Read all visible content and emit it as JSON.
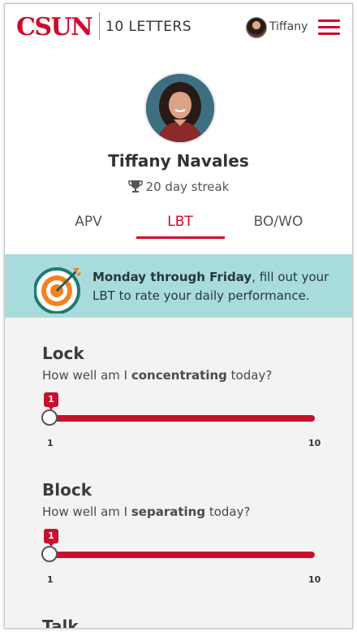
{
  "header": {
    "logo": "CSUN",
    "app_title": "10 LETTERS",
    "user_name": "Tiffany",
    "menu_icon": "hamburger-menu-icon"
  },
  "profile": {
    "name": "Tiffany Navales",
    "streak_icon": "trophy-icon",
    "streak_text": "20 day streak"
  },
  "tabs": [
    {
      "label": "APV",
      "active": false
    },
    {
      "label": "LBT",
      "active": true
    },
    {
      "label": "BO/WO",
      "active": false
    }
  ],
  "banner": {
    "icon": "target-icon",
    "bold": "Monday through Friday",
    "text": ", fill out your LBT to rate your daily performance.",
    "bg_color": "#a8dcdc"
  },
  "questions": [
    {
      "title": "Lock",
      "sub_prefix": "How well am I ",
      "sub_bold": "concentrating",
      "sub_suffix": " today?",
      "value": 1,
      "min": 1,
      "max": 10
    },
    {
      "title": "Block",
      "sub_prefix": "How well am I ",
      "sub_bold": "separating",
      "sub_suffix": " today?",
      "value": 1,
      "min": 1,
      "max": 10
    },
    {
      "title": "Talk"
    }
  ],
  "colors": {
    "accent": "#d2072b",
    "slider": "#c8102e"
  }
}
